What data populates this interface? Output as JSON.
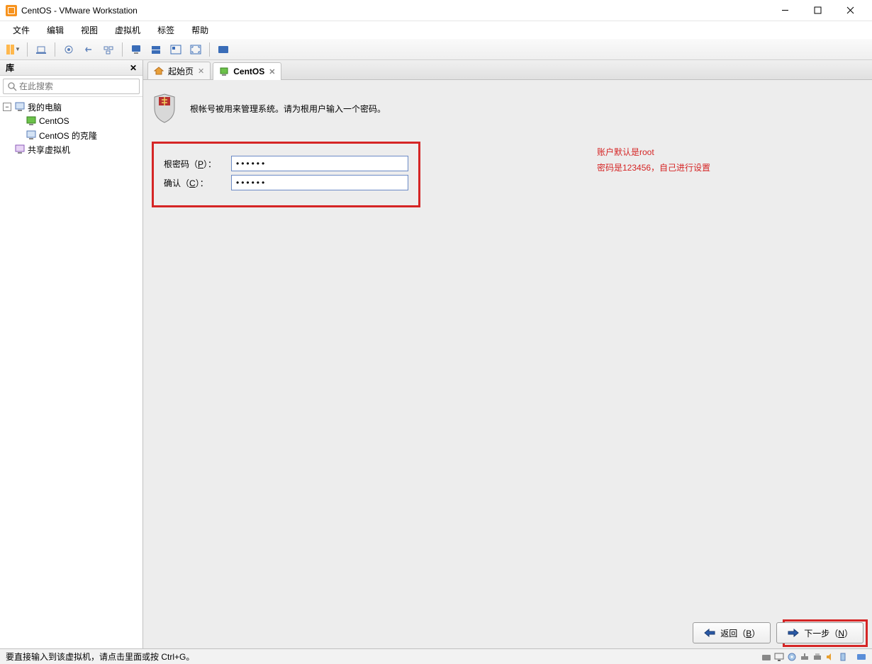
{
  "title": "CentOS - VMware Workstation",
  "menu": {
    "file": "文件",
    "edit": "编辑",
    "view": "视图",
    "vm": "虚拟机",
    "tabs": "标签",
    "help": "帮助"
  },
  "sidebar": {
    "title": "库",
    "search_placeholder": "在此搜索",
    "tree": {
      "root1": "我的电脑",
      "child1": "CentOS",
      "child2": "CentOS 的克隆",
      "root2": "共享虚拟机"
    }
  },
  "tabs": {
    "home": "起始页",
    "centos": "CentOS"
  },
  "install": {
    "instruction": "根帐号被用来管理系统。请为根用户输入一个密码。",
    "root_pw_label_pre": "根密码（",
    "root_pw_key": "P",
    "root_pw_label_post": "）：",
    "confirm_label_pre": "确认（",
    "confirm_key": "C",
    "confirm_label_post": "）：",
    "pw_value": "••••••",
    "confirm_value": "••••••",
    "back_label_pre": "返回（",
    "back_key": "B",
    "back_label_post": "）",
    "next_label_pre": "下一步（",
    "next_key": "N",
    "next_label_post": "）"
  },
  "annotation": {
    "line1": "账户默认是root",
    "line2": "密码是123456，自己进行设置"
  },
  "statusbar": "要直接输入到该虚拟机，请点击里面或按 Ctrl+G。"
}
